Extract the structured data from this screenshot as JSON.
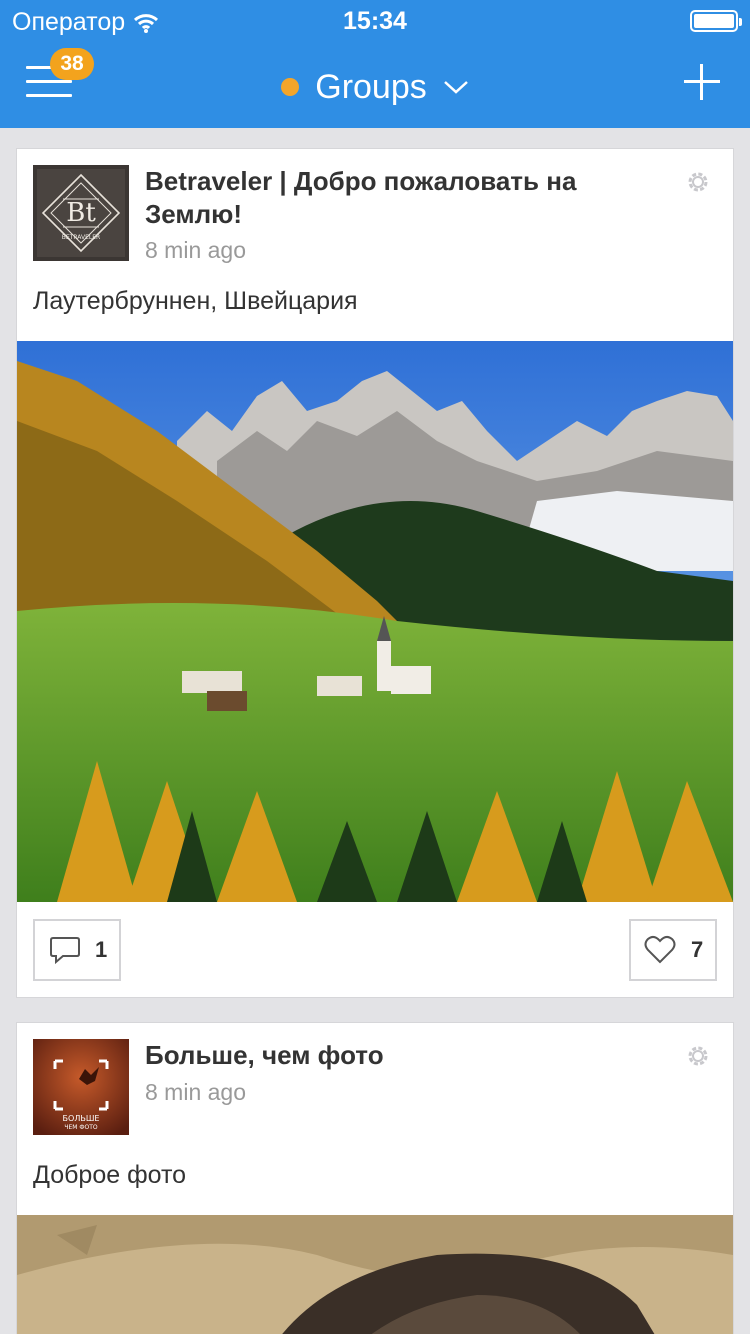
{
  "status_bar": {
    "carrier": "Оператор",
    "time": "15:34"
  },
  "nav": {
    "badge": "38",
    "title": "Groups",
    "icons": [
      "menu-icon",
      "chevron-down-icon",
      "plus-icon"
    ],
    "status_dot_color": "#f3a52a",
    "accent_color": "#2f8ee4"
  },
  "posts": [
    {
      "title": "Betraveler | Добро пожаловать на Землю!",
      "time": "8 min ago",
      "text": "Лаутербруннен, Швейцария",
      "avatar_text": "BETRAVELER",
      "comments": "1",
      "likes": "7"
    },
    {
      "title": "Больше, чем фото",
      "time": "8 min ago",
      "text": "Доброе фото",
      "avatar_text_1": "БОЛЬШЕ",
      "avatar_text_2": "ЧЕМ ФОТО"
    }
  ]
}
